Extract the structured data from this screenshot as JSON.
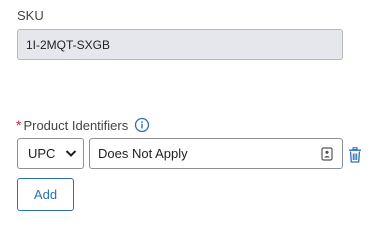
{
  "sku": {
    "label": "SKU",
    "value": "1I-2MQT-SXGB"
  },
  "product_identifiers": {
    "required_marker": "*",
    "label": "Product Identifiers",
    "info_icon": "info-icon",
    "type_select": {
      "selected": "UPC"
    },
    "value_input": {
      "value": "Does Not Apply"
    },
    "delete_icon": "trash-icon"
  },
  "add_button": {
    "label": "Add"
  },
  "colors": {
    "accent": "#2d6fb5",
    "required": "#c0282d",
    "readonly_bg": "#e5e7ec"
  }
}
